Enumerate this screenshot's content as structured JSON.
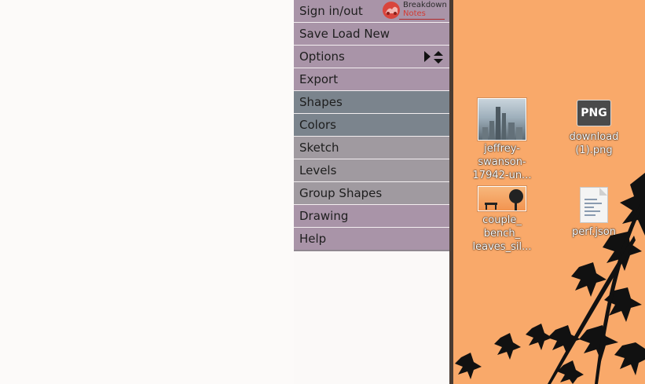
{
  "menu": {
    "items": [
      {
        "label": "Sign in/out",
        "style": "mauve"
      },
      {
        "label": "Save Load New",
        "style": "mauve"
      },
      {
        "label": "Options",
        "style": "mauve"
      },
      {
        "label": "Export",
        "style": "mauve"
      },
      {
        "label": "Shapes",
        "style": "slate"
      },
      {
        "label": "Colors",
        "style": "slate"
      },
      {
        "label": "Sketch",
        "style": "grey"
      },
      {
        "label": "Levels",
        "style": "grey"
      },
      {
        "label": "Group Shapes",
        "style": "grey"
      },
      {
        "label": "Drawing",
        "style": "mauve"
      },
      {
        "label": "Help",
        "style": "mauve"
      }
    ],
    "logo": {
      "line1": "Breakdown",
      "line2": "Notes"
    }
  },
  "desktop": {
    "icons": [
      {
        "lines": [
          "jeffrey-",
          "swanson-",
          "17942-un..."
        ]
      },
      {
        "lines": [
          "download",
          "(1).png"
        ],
        "badge": "PNG"
      },
      {
        "lines": [
          "couple_",
          "bench_",
          "leaves_sil..."
        ]
      },
      {
        "lines": [
          "perf.json"
        ]
      }
    ]
  },
  "colors": {
    "menu_mauve": "#a994a8",
    "menu_slate": "#7b848d",
    "menu_grey": "#a09aa0",
    "desktop_orange": "#f9a96a",
    "logo_red": "#d23b33"
  }
}
